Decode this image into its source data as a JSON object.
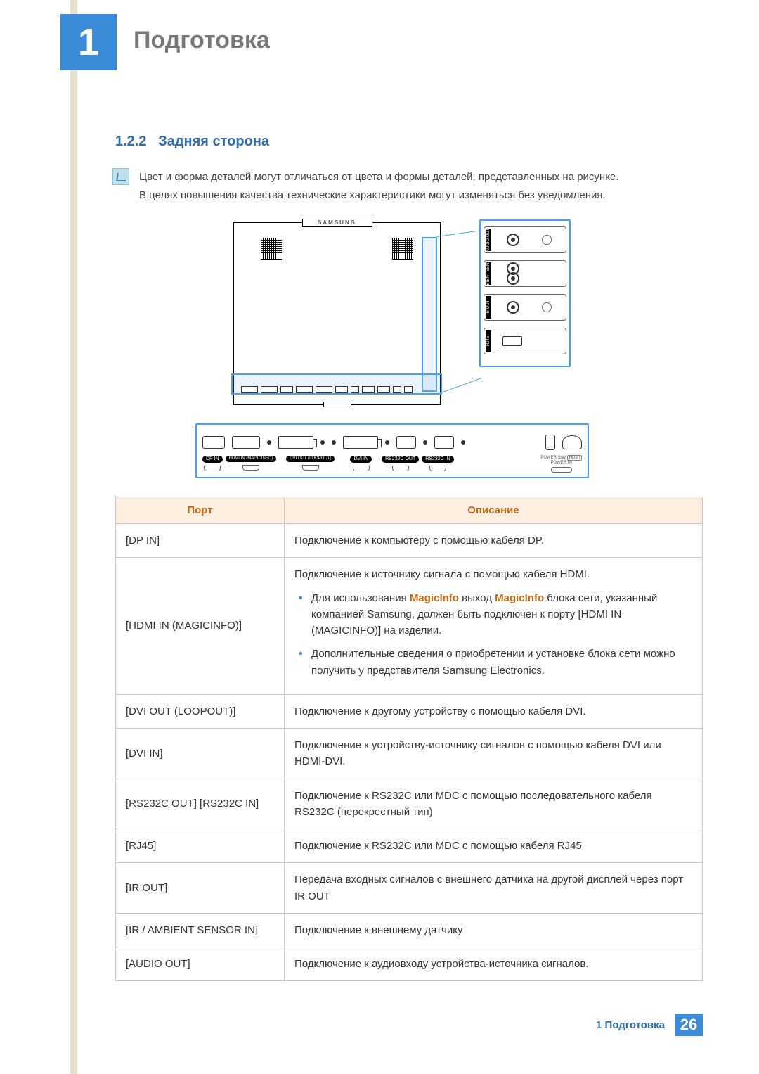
{
  "chapter": {
    "number": "1",
    "title": "Подготовка"
  },
  "section": {
    "number": "1.2.2",
    "title": "Задняя сторона"
  },
  "note": {
    "line1": "Цвет и форма деталей могут отличаться от цвета и формы деталей, представленных на рисунке.",
    "line2": "В целях повышения качества технические характеристики могут изменяться без уведомления."
  },
  "diagram": {
    "brand": "SAMSUNG",
    "side_ports": [
      "AUDIO OUT",
      "IR / AMBIENT SENSOR IN",
      "IR OUT",
      "RJ45"
    ],
    "bottom_ports": {
      "dp": "DP IN",
      "hdmi": "HDMI IN (MAGICINFO)",
      "dviout": "DVI OUT (LOOPOUT)",
      "dviin": "DVI IN",
      "rsout": "RS232C OUT",
      "rsin": "RS232C IN",
      "powersw": "POWER S/W",
      "powerin": "POWER IN",
      "hdmi_mark": "HDMI"
    }
  },
  "table": {
    "header_port": "Порт",
    "header_desc": "Описание",
    "rows": [
      {
        "port": "[DP IN]",
        "desc": "Подключение к компьютеру с помощью кабеля DP."
      },
      {
        "port": "[HDMI IN (MAGICINFO)]",
        "desc_first": "Подключение к источнику сигнала с помощью кабеля HDMI.",
        "bullet1_pre": "Для использования ",
        "bullet1_kw1": "MagicInfo",
        "bullet1_mid": " выход ",
        "bullet1_kw2": "MagicInfo",
        "bullet1_post": " блока сети, указанный компанией Samsung, должен быть подключен к порту [HDMI IN (MAGICINFO)] на изделии.",
        "bullet2": "Дополнительные сведения о приобретении и установке блока сети можно получить у представителя Samsung Electronics."
      },
      {
        "port": "[DVI OUT (LOOPOUT)]",
        "desc": "Подключение к другому устройству с помощью кабеля DVI."
      },
      {
        "port": "[DVI IN]",
        "desc": "Подключение к устройству-источнику сигналов с помощью кабеля DVI или HDMI-DVI."
      },
      {
        "port": "[RS232C OUT] [RS232C IN]",
        "desc": "Подключение к RS232C или MDC с помощью последовательного кабеля RS232C (перекрестный тип)"
      },
      {
        "port": "[RJ45]",
        "desc": "Подключение к RS232C или MDC с помощью кабеля RJ45"
      },
      {
        "port": "[IR OUT]",
        "desc": "Передача входных сигналов с внешнего датчика на другой дисплей через порт IR OUT"
      },
      {
        "port": "[IR / AMBIENT SENSOR IN]",
        "desc": "Подключение к внешнему датчику"
      },
      {
        "port": "[AUDIO OUT]",
        "desc": "Подключение к аудиовходу устройства-источника сигналов."
      }
    ]
  },
  "footer": {
    "text": "1 Подготовка",
    "page": "26"
  }
}
